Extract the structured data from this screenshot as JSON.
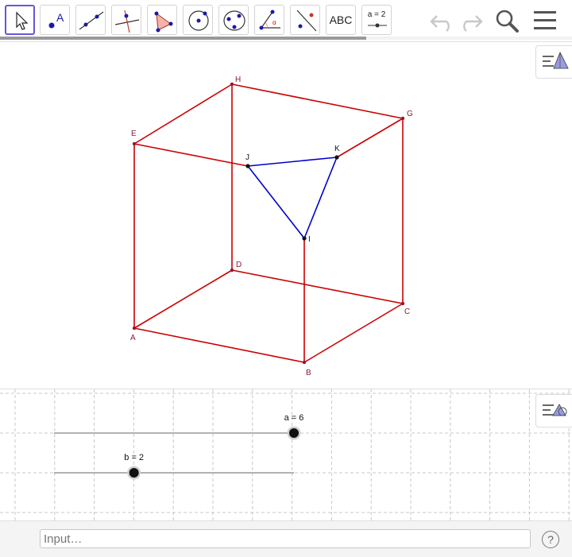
{
  "toolbar": {
    "tools": [
      {
        "name": "move-tool",
        "active": true
      },
      {
        "name": "point-tool"
      },
      {
        "name": "line-tool"
      },
      {
        "name": "perpendicular-tool"
      },
      {
        "name": "polygon-tool"
      },
      {
        "name": "circle-tool"
      },
      {
        "name": "conic-tool"
      },
      {
        "name": "angle-tool"
      },
      {
        "name": "reflect-tool"
      },
      {
        "name": "text-tool",
        "label": "ABC"
      },
      {
        "name": "slider-tool",
        "label": "a = 2"
      }
    ],
    "scroll_fraction": 0.64
  },
  "view3d": {
    "points": {
      "A": {
        "label": "A"
      },
      "B": {
        "label": "B"
      },
      "C": {
        "label": "C"
      },
      "D": {
        "label": "D"
      },
      "E": {
        "label": "E"
      },
      "G": {
        "label": "G"
      },
      "H": {
        "label": "H"
      },
      "I": {
        "label": "I"
      },
      "J": {
        "label": "J"
      },
      "K": {
        "label": "K"
      }
    },
    "colors": {
      "cube_edge": "#cc0000",
      "triangle_edge": "#0000cc",
      "point_label": "#8b1a3a"
    }
  },
  "view2d": {
    "sliders": [
      {
        "name": "a",
        "label": "a = 6",
        "value": 6,
        "min": 0,
        "max": 6
      },
      {
        "name": "b",
        "label": "b = 2",
        "value": 2,
        "min": 0,
        "max": 6
      }
    ]
  },
  "input_bar": {
    "placeholder": "Input…",
    "help_label": "?"
  }
}
